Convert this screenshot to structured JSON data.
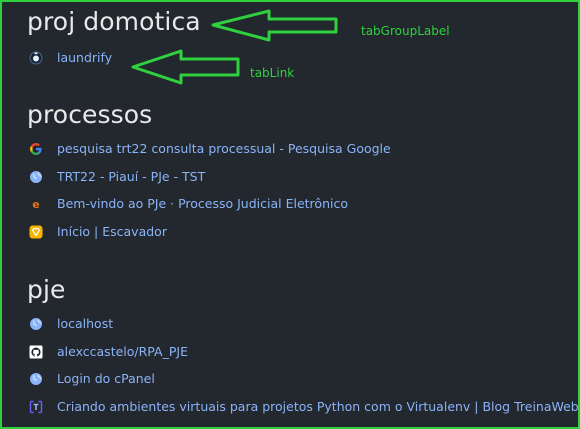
{
  "groups": [
    {
      "label": "proj domotica",
      "tabs": [
        {
          "title": "laundrify",
          "icon": "laundrify-icon"
        }
      ]
    },
    {
      "label": "processos",
      "tabs": [
        {
          "title": "pesquisa trt22 consulta processual - Pesquisa Google",
          "icon": "google-icon"
        },
        {
          "title": "TRT22 - Piauí - PJe - TST",
          "icon": "globe-icon"
        },
        {
          "title": "Bem-vindo ao PJe · Processo Judicial Eletrônico",
          "icon": "pje-icon"
        },
        {
          "title": "Início | Escavador",
          "icon": "escavador-icon"
        }
      ]
    },
    {
      "label": "pje",
      "tabs": [
        {
          "title": "localhost",
          "icon": "globe-icon"
        },
        {
          "title": "alexccastelo/RPA_PJE",
          "icon": "github-icon"
        },
        {
          "title": "Login do cPanel",
          "icon": "globe-icon"
        },
        {
          "title": "Criando ambientes virtuais para projetos Python com o Virtualenv | Blog TreinaWeb",
          "icon": "treinaweb-icon"
        }
      ]
    }
  ],
  "annotations": {
    "group_label_note": "tabGroupLabel",
    "tab_link_note": "tabLink"
  },
  "colors": {
    "background": "#23272e",
    "group_label": "#e9e9ea",
    "link": "#8ab4f8",
    "annotation": "#2fd13f"
  }
}
